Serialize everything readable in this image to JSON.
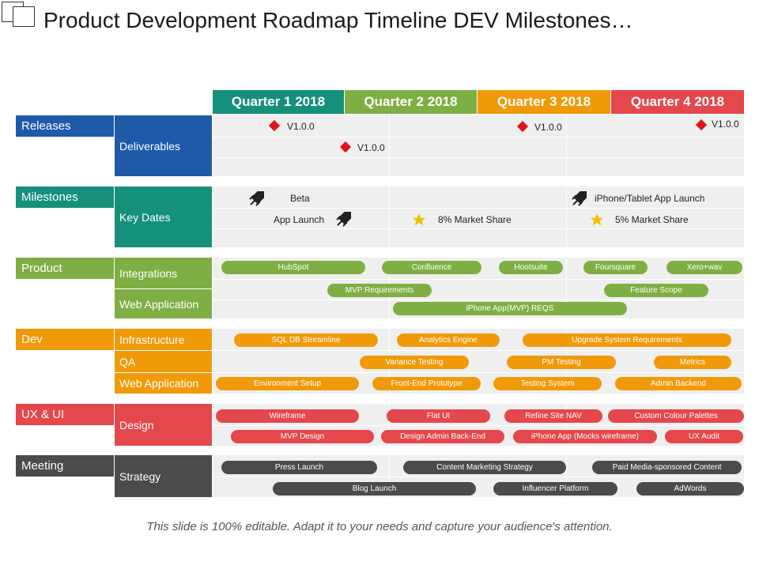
{
  "title": "Product Development Roadmap Timeline DEV Milestones…",
  "footer": "This slide is 100% editable. Adapt it to your needs and capture your audience's attention.",
  "quarters": [
    "Quarter 1 2018",
    "Quarter 2 2018",
    "Quarter 3 2018",
    "Quarter 4 2018"
  ],
  "colors": {
    "teal": "#15907a",
    "green": "#7faf44",
    "orange": "#f09a0a",
    "red": "#e4474c",
    "blue": "#1e5aa8",
    "gray": "#4b4b4b",
    "star": "#f3c000",
    "diamond": "#e1131b"
  },
  "categories": {
    "releases": "Releases",
    "milestones": "Milestones",
    "product": "Product",
    "dev": "Dev",
    "uxui": "UX & UI",
    "meeting": "Meeting"
  },
  "subs": {
    "deliverables": "Deliverables",
    "key_dates": "Key Dates",
    "integrations": "Integrations",
    "web_app_product": "Web Application",
    "infrastructure": "Infrastructure",
    "qa": "QA",
    "web_app_dev": "Web Application",
    "design": "Design",
    "strategy": "Strategy"
  },
  "releases": {
    "v1": "V1.0.0",
    "v2": "V1.0.0",
    "v3": "V1.0.0",
    "v4": "V1.0.0"
  },
  "milestones": {
    "beta": "Beta",
    "app_launch": "App Launch",
    "market8": "8% Market Share",
    "iphone_launch": "iPhone/Tablet  App Launch",
    "market5": "5% Market Share"
  },
  "product_tasks": {
    "hubspot": "HubSpot",
    "confluence": "Confluence",
    "hootsuite": "Hootsuite",
    "foursquare": "Foursquare",
    "xero": "Xero+wav",
    "mvp_req": "MVP Requirements",
    "feature_scope": "Feature Scope",
    "iphone_reqs": "iPhone App(MVP) REQS"
  },
  "dev_tasks": {
    "sql": "SQL DB Streamline",
    "analytics": "Analytics Engine",
    "upgrade": "Upgrade System  Requirements",
    "variance": "Variance Testing",
    "pm_testing": "PM  Testing",
    "metrics": "Metrics",
    "env": "Environment Setup",
    "frontend": "Front-End Prototype",
    "testing_system": "Testing System",
    "admin": "Admin Backend"
  },
  "ux_tasks": {
    "wireframe": "Wireframe",
    "flat_ui": "Flat UI",
    "refine": "Refine Site NAV",
    "palettes": "Custom Colour Palettes",
    "mvp_design": "MVP Design",
    "admin_design": "Design Admin Back-End",
    "iphone_mock": "iPhone App (Mocks wireframe)",
    "ux_audit": "UX Audit"
  },
  "meeting_tasks": {
    "press": "Press Launch",
    "content": "Content Marketing Strategy",
    "paid": "Paid Media-sponsored Content",
    "blog": "Blog Launch",
    "influencer": "Influencer Platform",
    "adwords": "AdWords"
  }
}
